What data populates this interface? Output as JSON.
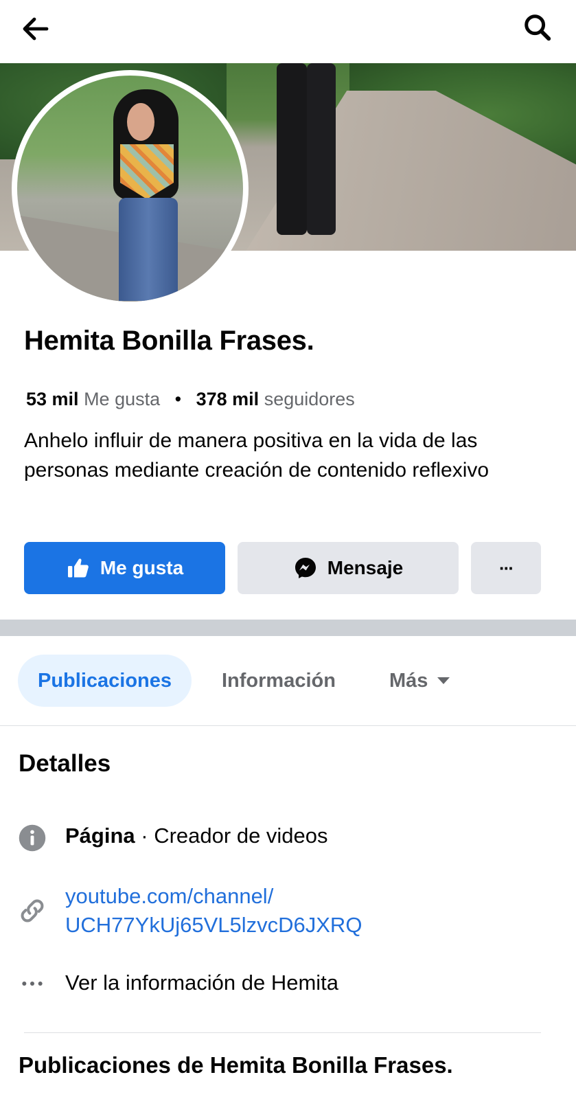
{
  "topbar": {
    "back_icon": "arrow-left-icon",
    "search_icon": "search-icon"
  },
  "profile": {
    "name": "Hemita Bonilla Frases.",
    "likes_count": "53 mil",
    "likes_label": "Me gusta",
    "followers_count": "378 mil",
    "followers_label": "seguidores",
    "separator": "•",
    "bio": "Anhelo influir de manera positiva en la vida de las personas mediante creación de contenido reflexivo"
  },
  "actions": {
    "like_label": "Me gusta",
    "message_label": "Mensaje",
    "more_label": "···"
  },
  "tabs": [
    {
      "label": "Publicaciones",
      "active": true
    },
    {
      "label": "Información",
      "active": false
    },
    {
      "label": "Más",
      "active": false
    }
  ],
  "details": {
    "title": "Detalles",
    "category_prefix": "Página",
    "category_sep": " · ",
    "category": "Creador de videos",
    "link_line1": "youtube.com/channel/",
    "link_line2": "UCH77YkUj65VL5lzvcD6JXRQ",
    "see_info": "Ver la información de Hemita"
  },
  "posts": {
    "title": "Publicaciones de Hemita Bonilla Frases."
  },
  "colors": {
    "accent": "#1b74e4",
    "link": "#216fdb",
    "secondary_text": "#65676b",
    "button_gray": "#e4e6eb"
  }
}
